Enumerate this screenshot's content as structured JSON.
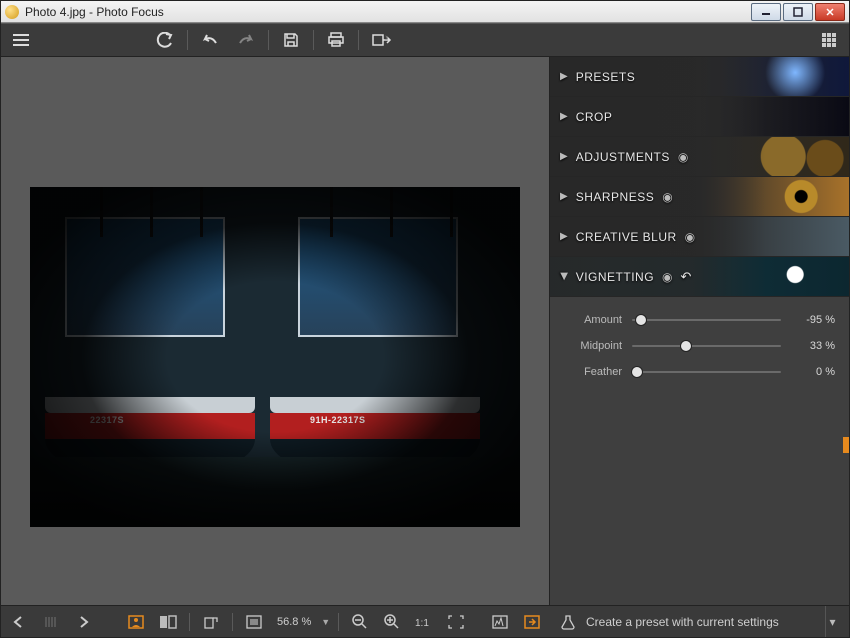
{
  "window": {
    "title": "Photo 4.jpg - Photo Focus"
  },
  "panels": {
    "presets": "PRESETS",
    "crop": "CROP",
    "adjustments": "ADJUSTMENTS",
    "sharpness": "SHARPNESS",
    "creative_blur": "CREATIVE BLUR",
    "vignetting": "VIGNETTING"
  },
  "vignetting": {
    "amount": {
      "label": "Amount",
      "value": "-95 %",
      "pos": 3
    },
    "midpoint": {
      "label": "Midpoint",
      "value": "33 %",
      "pos": 33
    },
    "feather": {
      "label": "Feather",
      "value": "0 %",
      "pos": 0
    }
  },
  "preset_bar": {
    "label": "Create a preset with current settings"
  },
  "bottom": {
    "zoom": "56.8 %"
  },
  "image": {
    "reg_left": "22317S",
    "reg_right": "91H-22317S"
  },
  "colors": {
    "accent": "#e68a1e"
  }
}
